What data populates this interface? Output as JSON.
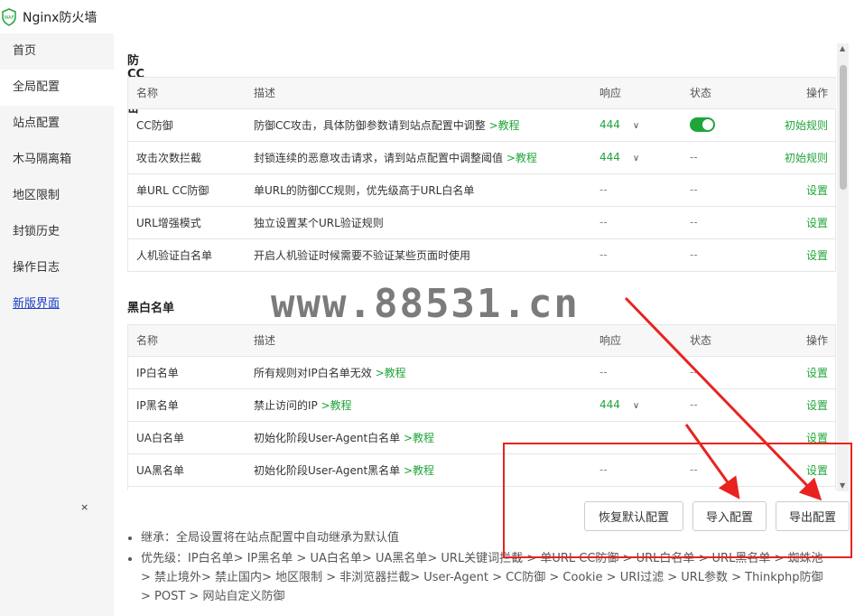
{
  "app": {
    "title": "Nginx防火墙",
    "logo_text": "WAF"
  },
  "sidebar": {
    "items": [
      {
        "label": "首页"
      },
      {
        "label": "全局配置"
      },
      {
        "label": "站点配置"
      },
      {
        "label": "木马隔离箱"
      },
      {
        "label": "地区限制"
      },
      {
        "label": "封锁历史"
      },
      {
        "label": "操作日志"
      },
      {
        "label": "新版界面"
      }
    ],
    "close": "×"
  },
  "headers": {
    "name": "名称",
    "desc": "描述",
    "response": "响应",
    "status": "状态",
    "action": "操作"
  },
  "cc_section": {
    "title": "防CC攻击",
    "rows": [
      {
        "name": "CC防御",
        "desc": "防御CC攻击，具体防御参数请到站点配置中调整",
        "link": ">教程",
        "response": "444",
        "status": "",
        "action": "初始规则"
      },
      {
        "name": "攻击次数拦截",
        "desc": "封锁连续的恶意攻击请求，请到站点配置中调整阈值",
        "link": ">教程",
        "response": "444",
        "status": "--",
        "action": "初始规则"
      },
      {
        "name": "单URL CC防御",
        "desc": "单URL的防御CC规则，优先级高于URL白名单",
        "link": "",
        "response": "--",
        "status": "--",
        "action": "设置"
      },
      {
        "name": "URL增强模式",
        "desc": "独立设置某个URL验证规则",
        "link": "",
        "response": "--",
        "status": "--",
        "action": "设置"
      },
      {
        "name": "人机验证白名单",
        "desc": "开启人机验证时候需要不验证某些页面时使用",
        "link": "",
        "response": "--",
        "status": "--",
        "action": "设置"
      }
    ]
  },
  "bw_section": {
    "title": "黑白名单",
    "rows": [
      {
        "name": "IP白名单",
        "desc": "所有规则对IP白名单无效",
        "link": ">教程",
        "response": "--",
        "status": "--",
        "action": "设置"
      },
      {
        "name": "IP黑名单",
        "desc": "禁止访问的IP",
        "link": ">教程",
        "response": "444",
        "status": "--",
        "action": "设置"
      },
      {
        "name": "UA白名单",
        "desc": "初始化阶段User-Agent白名单",
        "link": ">教程",
        "response": "",
        "status": "",
        "action": "设置"
      },
      {
        "name": "UA黑名单",
        "desc": "初始化阶段User-Agent黑名单",
        "link": ">教程",
        "response": "--",
        "status": "--",
        "action": "设置"
      }
    ]
  },
  "buttons": {
    "restore": "恢复默认配置",
    "import": "导入配置",
    "export": "导出配置"
  },
  "notes": {
    "inherit": "继承：全局设置将在站点配置中自动继承为默认值",
    "priority": "优先级：IP白名单> IP黑名单 > UA白名单> UA黑名单> URL关键词拦截 > 单URL CC防御 > URL白名单 > URL黑名单 > 蜘蛛池 > 禁止境外> 禁止国内> 地区限制 > 非浏览器拦截> User-Agent > CC防御 > Cookie > URI过滤 > URL参数 > Thinkphp防御> POST > 网站自定义防御"
  },
  "watermark": "www.88531.cn",
  "colors": {
    "accent": "#20a53a",
    "annotation": "#e8231f"
  }
}
